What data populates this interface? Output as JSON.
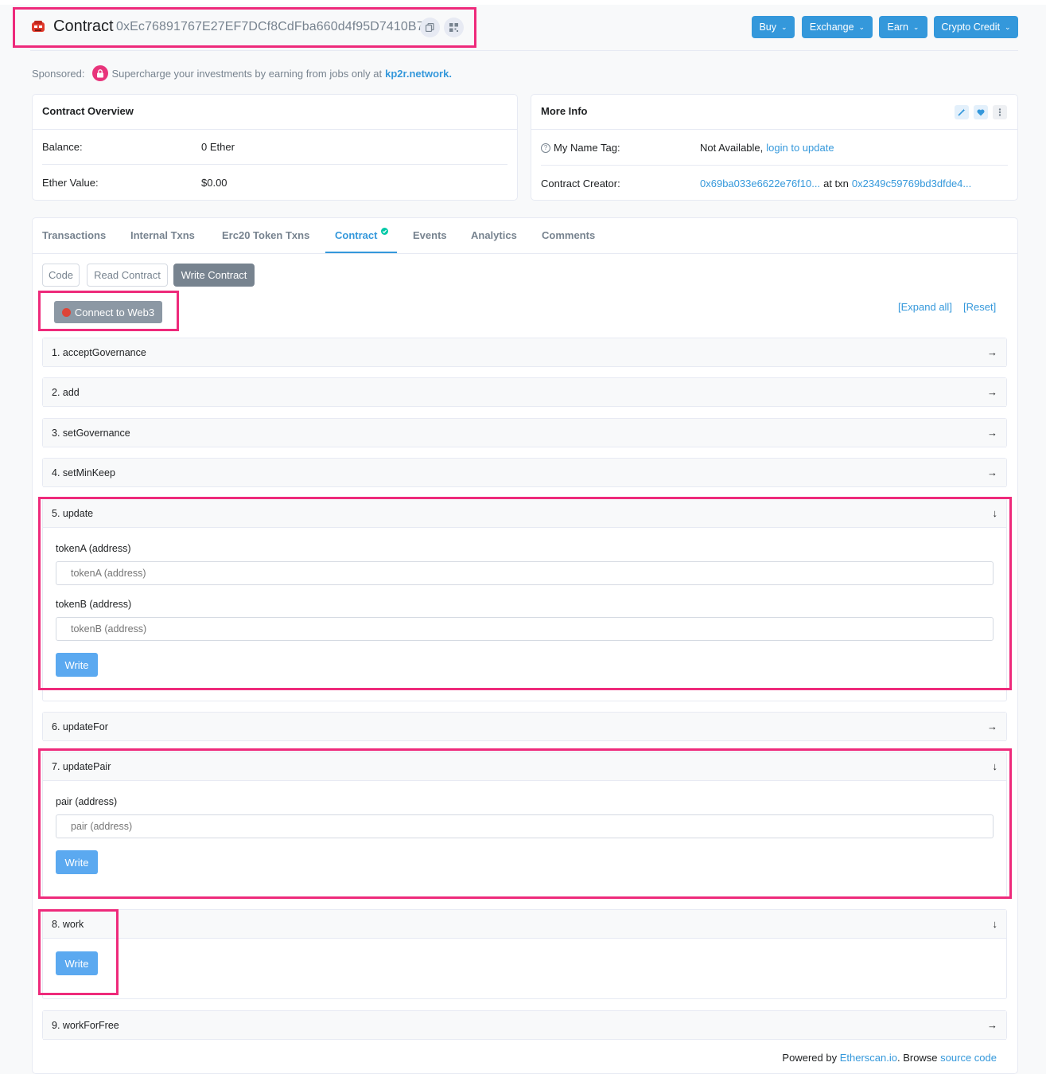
{
  "header": {
    "title": "Contract",
    "address": "0xEc76891767E27EF7DCf8CdFba660d4f95D7410B7",
    "buttons": [
      {
        "label": "Buy"
      },
      {
        "label": "Exchange"
      },
      {
        "label": "Earn"
      },
      {
        "label": "Crypto Credit"
      }
    ]
  },
  "sponsor": {
    "prefix": "Sponsored:",
    "text": "Supercharge your investments by earning from jobs only at",
    "link": "kp2r.network."
  },
  "overview": {
    "title": "Contract Overview",
    "balance_label": "Balance:",
    "balance_value": "0 Ether",
    "value_label": "Ether Value:",
    "value_value": "$0.00"
  },
  "more_info": {
    "title": "More Info",
    "name_tag_label": "My Name Tag:",
    "name_tag_value": "Not Available,",
    "name_tag_link": "login to update",
    "creator_label": "Contract Creator:",
    "creator_address": "0x69ba033e6622e76f10...",
    "creator_at": "at txn",
    "creator_txn": "0x2349c59769bd3dfde4..."
  },
  "tabs": [
    {
      "label": "Transactions"
    },
    {
      "label": "Internal Txns"
    },
    {
      "label": "Erc20 Token Txns"
    },
    {
      "label": "Contract"
    },
    {
      "label": "Events"
    },
    {
      "label": "Analytics"
    },
    {
      "label": "Comments"
    }
  ],
  "subtabs": [
    {
      "label": "Code"
    },
    {
      "label": "Read Contract"
    },
    {
      "label": "Write Contract"
    }
  ],
  "connect_label": "Connect to Web3",
  "expand_all": "[Expand all]",
  "reset": "[Reset]",
  "functions": [
    {
      "label": "1. acceptGovernance"
    },
    {
      "label": "2. add"
    },
    {
      "label": "3. setGovernance"
    },
    {
      "label": "4. setMinKeep"
    },
    {
      "label": "5. update",
      "params": [
        {
          "label": "tokenA (address)",
          "placeholder": "tokenA (address)"
        },
        {
          "label": "tokenB (address)",
          "placeholder": "tokenB (address)"
        }
      ]
    },
    {
      "label": "6. updateFor"
    },
    {
      "label": "7. updatePair",
      "params": [
        {
          "label": "pair (address)",
          "placeholder": "pair (address)"
        }
      ]
    },
    {
      "label": "8. work"
    },
    {
      "label": "9. workForFree"
    }
  ],
  "write_label": "Write",
  "footer": {
    "powered": "Powered by",
    "site": "Etherscan.io",
    "browse": ". Browse",
    "source": "source code"
  },
  "colors": {
    "accent": "#3498db",
    "highlight": "#ee2a7b",
    "write_button": "#5ba9f0"
  }
}
